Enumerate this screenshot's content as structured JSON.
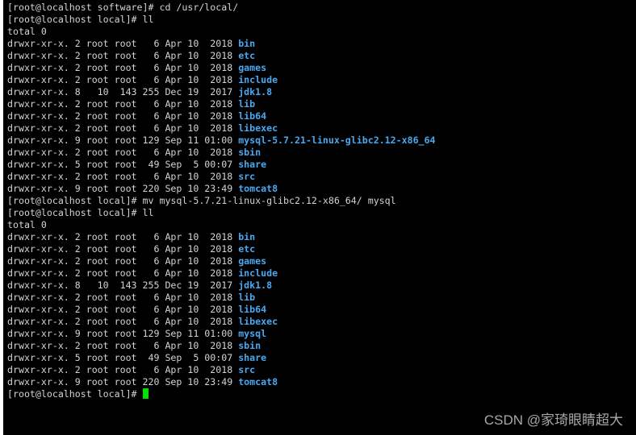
{
  "terminal": {
    "lines": [
      {
        "text": "[root@localhost software]# cd /usr/local/"
      },
      {
        "text": "[root@localhost local]# ll"
      },
      {
        "text": "total 0"
      },
      {
        "text": "drwxr-xr-x. 2 root root   6 Apr 10  2018 ",
        "dir": "bin"
      },
      {
        "text": "drwxr-xr-x. 2 root root   6 Apr 10  2018 ",
        "dir": "etc"
      },
      {
        "text": "drwxr-xr-x. 2 root root   6 Apr 10  2018 ",
        "dir": "games"
      },
      {
        "text": "drwxr-xr-x. 2 root root   6 Apr 10  2018 ",
        "dir": "include"
      },
      {
        "text": "drwxr-xr-x. 8   10  143 255 Dec 19  2017 ",
        "dir": "jdk1.8"
      },
      {
        "text": "drwxr-xr-x. 2 root root   6 Apr 10  2018 ",
        "dir": "lib"
      },
      {
        "text": "drwxr-xr-x. 2 root root   6 Apr 10  2018 ",
        "dir": "lib64"
      },
      {
        "text": "drwxr-xr-x. 2 root root   6 Apr 10  2018 ",
        "dir": "libexec"
      },
      {
        "text": "drwxr-xr-x. 9 root root 129 Sep 11 01:00 ",
        "dir": "mysql-5.7.21-linux-glibc2.12-x86_64"
      },
      {
        "text": "drwxr-xr-x. 2 root root   6 Apr 10  2018 ",
        "dir": "sbin"
      },
      {
        "text": "drwxr-xr-x. 5 root root  49 Sep  5 00:07 ",
        "dir": "share"
      },
      {
        "text": "drwxr-xr-x. 2 root root   6 Apr 10  2018 ",
        "dir": "src"
      },
      {
        "text": "drwxr-xr-x. 9 root root 220 Sep 10 23:49 ",
        "dir": "tomcat8"
      },
      {
        "text": "[root@localhost local]# mv mysql-5.7.21-linux-glibc2.12-x86_64/ mysql"
      },
      {
        "text": "[root@localhost local]# ll"
      },
      {
        "text": "total 0"
      },
      {
        "text": "drwxr-xr-x. 2 root root   6 Apr 10  2018 ",
        "dir": "bin"
      },
      {
        "text": "drwxr-xr-x. 2 root root   6 Apr 10  2018 ",
        "dir": "etc"
      },
      {
        "text": "drwxr-xr-x. 2 root root   6 Apr 10  2018 ",
        "dir": "games"
      },
      {
        "text": "drwxr-xr-x. 2 root root   6 Apr 10  2018 ",
        "dir": "include"
      },
      {
        "text": "drwxr-xr-x. 8   10  143 255 Dec 19  2017 ",
        "dir": "jdk1.8"
      },
      {
        "text": "drwxr-xr-x. 2 root root   6 Apr 10  2018 ",
        "dir": "lib"
      },
      {
        "text": "drwxr-xr-x. 2 root root   6 Apr 10  2018 ",
        "dir": "lib64"
      },
      {
        "text": "drwxr-xr-x. 2 root root   6 Apr 10  2018 ",
        "dir": "libexec"
      },
      {
        "text": "drwxr-xr-x. 9 root root 129 Sep 11 01:00 ",
        "dir": "mysql"
      },
      {
        "text": "drwxr-xr-x. 2 root root   6 Apr 10  2018 ",
        "dir": "sbin"
      },
      {
        "text": "drwxr-xr-x. 5 root root  49 Sep  5 00:07 ",
        "dir": "share"
      },
      {
        "text": "drwxr-xr-x. 2 root root   6 Apr 10  2018 ",
        "dir": "src"
      },
      {
        "text": "drwxr-xr-x. 9 root root 220 Sep 10 23:49 ",
        "dir": "tomcat8"
      }
    ],
    "prompt": "[root@localhost local]# "
  },
  "watermark": "CSDN @家琦眼睛超大",
  "colors": {
    "background": "#000000",
    "text": "#d4d4d4",
    "directory": "#4aa8f0",
    "cursor": "#00e000"
  }
}
